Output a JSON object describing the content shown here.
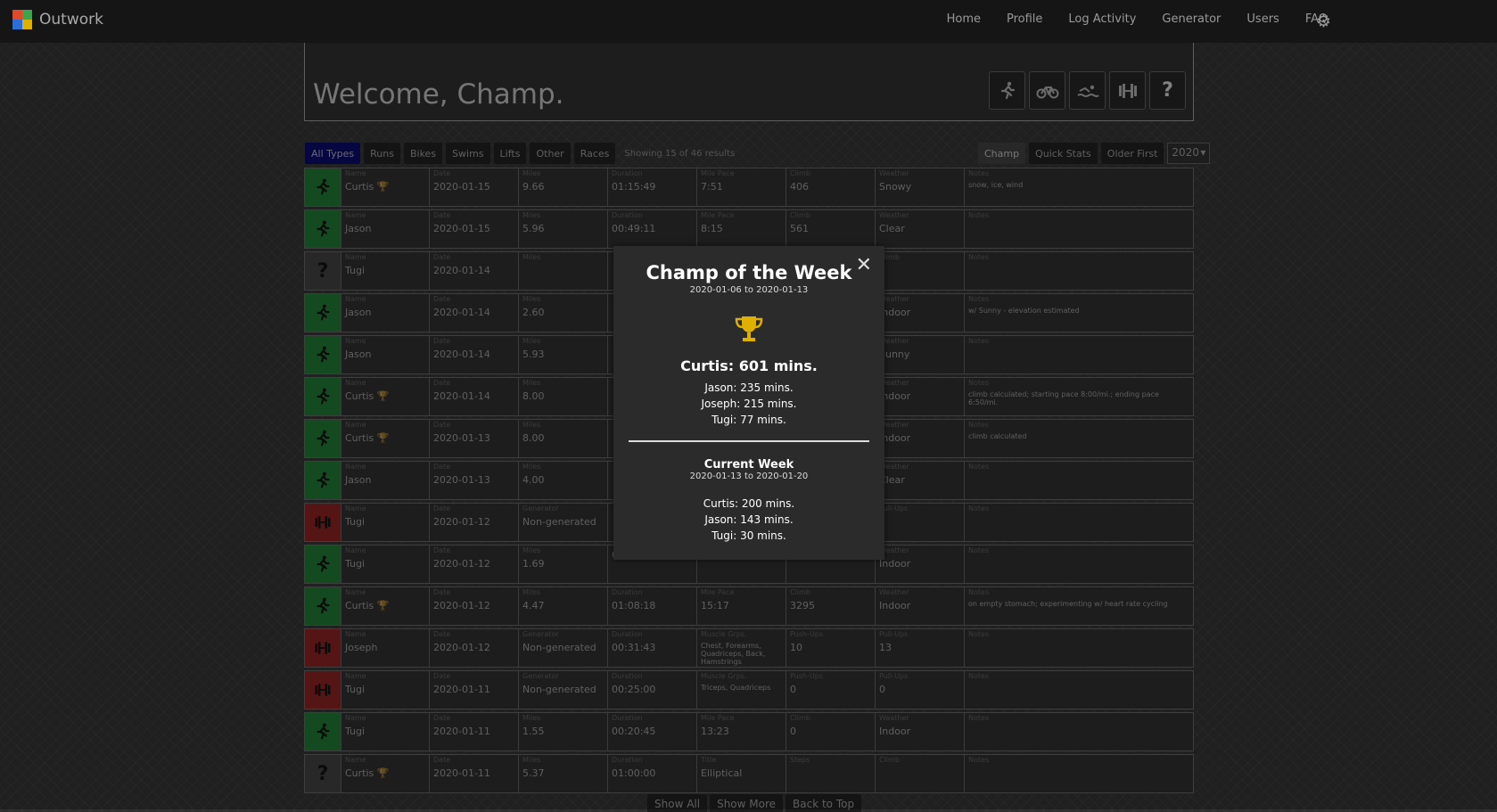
{
  "app": {
    "name": "Outwork"
  },
  "nav": {
    "links": [
      "Home",
      "Profile",
      "Log Activity",
      "Generator",
      "Users",
      "FAQ"
    ],
    "settings_icon": "gear-icon"
  },
  "welcome": {
    "title": "Welcome, Champ."
  },
  "filters": {
    "types": [
      "All Types",
      "Runs",
      "Bikes",
      "Swims",
      "Lifts",
      "Other",
      "Races"
    ],
    "showing": "Showing 15 of 46 results",
    "buttons": [
      "Champ",
      "Quick Stats",
      "Older First"
    ],
    "year": "2020"
  },
  "colors": {
    "run": "#1e6b2e",
    "lift": "#7a1f1f",
    "other": "#3a3a3a",
    "active_filter": "#0a0a5e",
    "trophy": "#e0b000"
  },
  "rows": [
    {
      "kind": "run",
      "name": "Curtis",
      "champ": true,
      "date": "2020-01-15",
      "c3l": "Miles",
      "c3": "9.66",
      "c4l": "Duration",
      "c4": "01:15:49",
      "c5l": "Mile Pace",
      "c5": "7:51",
      "c6l": "Climb",
      "c6": "406",
      "c7l": "Weather",
      "c7": "Snowy",
      "notes": "snow, ice, wind"
    },
    {
      "kind": "run",
      "name": "Jason",
      "champ": false,
      "date": "2020-01-15",
      "c3l": "Miles",
      "c3": "5.96",
      "c4l": "Duration",
      "c4": "00:49:11",
      "c5l": "Mile Pace",
      "c5": "8:15",
      "c6l": "Climb",
      "c6": "561",
      "c7l": "Weather",
      "c7": "Clear",
      "notes": ""
    },
    {
      "kind": "other",
      "name": "Tugi",
      "champ": false,
      "date": "2020-01-14",
      "c3l": "Miles",
      "c3": "",
      "c4l": "",
      "c4": "",
      "c5l": "",
      "c5": "",
      "c6l": "",
      "c6": "",
      "c7l": "Climb",
      "c7": "",
      "notes": ""
    },
    {
      "kind": "run",
      "name": "Jason",
      "champ": false,
      "date": "2020-01-14",
      "c3l": "Miles",
      "c3": "2.60",
      "c4l": "",
      "c4": "",
      "c5l": "",
      "c5": "",
      "c6l": "",
      "c6": "",
      "c7l": "Weather",
      "c7": "Indoor",
      "notes": "w/ Sunny - elevation estimated"
    },
    {
      "kind": "run",
      "name": "Jason",
      "champ": false,
      "date": "2020-01-14",
      "c3l": "Miles",
      "c3": "5.93",
      "c4l": "",
      "c4": "",
      "c5l": "",
      "c5": "",
      "c6l": "",
      "c6": "",
      "c7l": "Weather",
      "c7": "Sunny",
      "notes": ""
    },
    {
      "kind": "run",
      "name": "Curtis",
      "champ": true,
      "date": "2020-01-14",
      "c3l": "Miles",
      "c3": "8.00",
      "c4l": "",
      "c4": "",
      "c5l": "",
      "c5": "",
      "c6l": "",
      "c6": "",
      "c7l": "Weather",
      "c7": "Indoor",
      "notes": "climb calculated; starting pace 8:00/mi.; ending pace 6:50/mi."
    },
    {
      "kind": "run",
      "name": "Curtis",
      "champ": true,
      "date": "2020-01-13",
      "c3l": "Miles",
      "c3": "8.00",
      "c4l": "",
      "c4": "",
      "c5l": "",
      "c5": "",
      "c6l": "",
      "c6": "",
      "c7l": "Weather",
      "c7": "Indoor",
      "notes": "climb calculated"
    },
    {
      "kind": "run",
      "name": "Jason",
      "champ": false,
      "date": "2020-01-13",
      "c3l": "Miles",
      "c3": "4.00",
      "c4l": "",
      "c4": "",
      "c5l": "",
      "c5": "",
      "c6l": "",
      "c6": "",
      "c7l": "Weather",
      "c7": "Clear",
      "notes": ""
    },
    {
      "kind": "lift",
      "name": "Tugi",
      "champ": false,
      "date": "2020-01-12",
      "c3l": "Generator",
      "c3": "Non-generated",
      "c4l": "",
      "c4": "",
      "c5l": "",
      "c5": "",
      "c6l": "",
      "c6": "",
      "c7l": "Pull-Ups",
      "c7": "",
      "notes": ""
    },
    {
      "kind": "run",
      "name": "Tugi",
      "champ": false,
      "date": "2020-01-12",
      "c3l": "Miles",
      "c3": "1.69",
      "c4l": "",
      "c4": "00:20:00",
      "c5l": "",
      "c5": "15:25",
      "c6l": "",
      "c6": "0",
      "c7l": "Weather",
      "c7": "Indoor",
      "notes": ""
    },
    {
      "kind": "run",
      "name": "Curtis",
      "champ": true,
      "date": "2020-01-12",
      "c3l": "Miles",
      "c3": "4.47",
      "c4l": "Duration",
      "c4": "01:08:18",
      "c5l": "Mile Pace",
      "c5": "15:17",
      "c6l": "Climb",
      "c6": "3295",
      "c7l": "Weather",
      "c7": "Indoor",
      "notes": "on empty stomach; experimenting w/ heart rate cycling"
    },
    {
      "kind": "lift",
      "name": "Joseph",
      "champ": false,
      "date": "2020-01-12",
      "c3l": "Generator",
      "c3": "Non-generated",
      "c4l": "Duration",
      "c4": "00:31:43",
      "c5l": "Muscle Grps.",
      "c5": "Chest, Forearms, Quadriceps, Back, Hamstrings",
      "c6l": "Push-Ups",
      "c6": "10",
      "c7l": "Pull-Ups",
      "c7": "13",
      "notes": ""
    },
    {
      "kind": "lift",
      "name": "Tugi",
      "champ": false,
      "date": "2020-01-11",
      "c3l": "Generator",
      "c3": "Non-generated",
      "c4l": "Duration",
      "c4": "00:25:00",
      "c5l": "Muscle Grps.",
      "c5": "Triceps, Quadriceps",
      "c6l": "Push-Ups",
      "c6": "0",
      "c7l": "Pull-Ups",
      "c7": "0",
      "notes": ""
    },
    {
      "kind": "run",
      "name": "Tugi",
      "champ": false,
      "date": "2020-01-11",
      "c3l": "Miles",
      "c3": "1.55",
      "c4l": "Duration",
      "c4": "00:20:45",
      "c5l": "Mile Pace",
      "c5": "13:23",
      "c6l": "Climb",
      "c6": "0",
      "c7l": "Weather",
      "c7": "Indoor",
      "notes": ""
    },
    {
      "kind": "other",
      "name": "Curtis",
      "champ": true,
      "date": "2020-01-11",
      "c3l": "Miles",
      "c3": "5.37",
      "c4l": "Duration",
      "c4": "01:00:00",
      "c5l": "Title",
      "c5": "Elliptical",
      "c6l": "Steps",
      "c6": "",
      "c7l": "Climb",
      "c7": "",
      "notes": ""
    }
  ],
  "modal": {
    "title": "Champ of the Week",
    "range": "2020-01-06 to 2020-01-13",
    "champ": "Curtis: 601 mins.",
    "others": [
      "Jason: 235 mins.",
      "Joseph: 215 mins.",
      "Tugi: 77 mins."
    ],
    "current_title": "Current Week",
    "current_range": "2020-01-13 to 2020-01-20",
    "current": [
      "Curtis: 200 mins.",
      "Jason: 143 mins.",
      "Tugi: 30 mins."
    ],
    "close_icon": "close-icon"
  },
  "bottom": {
    "buttons": [
      "Show All",
      "Show More",
      "Back to Top"
    ]
  },
  "labels": {
    "name": "Name",
    "date": "Date",
    "notes": "Notes"
  }
}
